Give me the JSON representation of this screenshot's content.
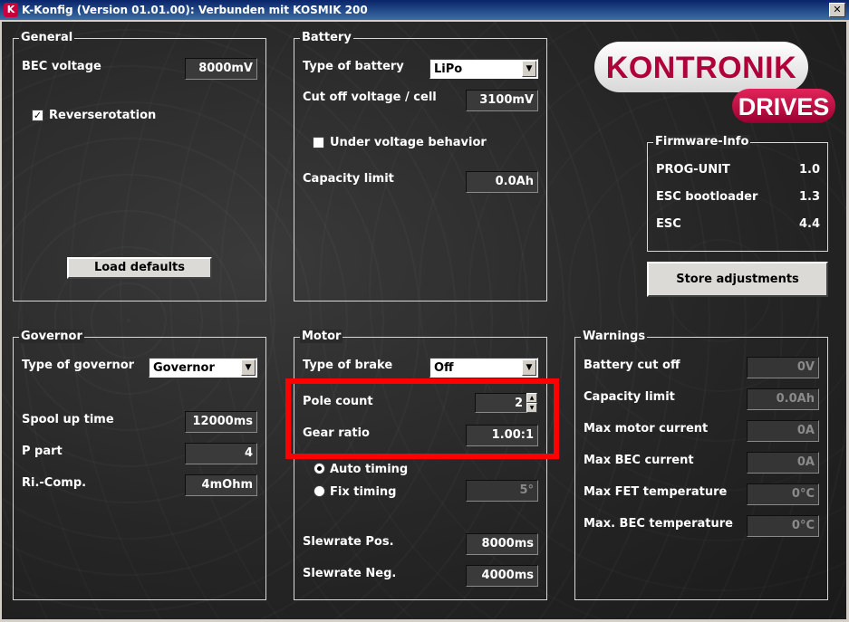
{
  "window": {
    "title": "K-Konfig (Version 01.01.00): Verbunden mit KOSMIK 200",
    "app_icon": "K",
    "close_glyph": "✕"
  },
  "logo": {
    "main": "KONTRONIK",
    "sub": "DRIVES"
  },
  "general": {
    "legend": "General",
    "bec_voltage_label": "BEC voltage",
    "bec_voltage_value": "8000mV",
    "reverserotation_label": "Reverserotation",
    "reverserotation_checked": true,
    "load_defaults_label": "Load defaults"
  },
  "battery": {
    "legend": "Battery",
    "type_label": "Type of battery",
    "type_value": "LiPo",
    "cutoff_label": "Cut off voltage / cell",
    "cutoff_value": "3100mV",
    "under_voltage_label": "Under voltage behavior",
    "under_voltage_checked": false,
    "capacity_label": "Capacity limit",
    "capacity_value": "0.0Ah"
  },
  "firmware": {
    "legend": "Firmware-Info",
    "rows": [
      {
        "label": "PROG-UNIT",
        "value": "1.0"
      },
      {
        "label": "ESC bootloader",
        "value": "1.3"
      },
      {
        "label": "ESC",
        "value": "4.4"
      }
    ],
    "store_label": "Store adjustments"
  },
  "governor": {
    "legend": "Governor",
    "type_label": "Type of governor",
    "type_value": "Governor",
    "spool_label": "Spool up time",
    "spool_value": "12000ms",
    "ppart_label": "P part",
    "ppart_value": "4",
    "ricomp_label": "Ri.-Comp.",
    "ricomp_value": "4mOhm"
  },
  "motor": {
    "legend": "Motor",
    "brake_label": "Type of brake",
    "brake_value": "Off",
    "pole_label": "Pole count",
    "pole_value": "2",
    "gear_label": "Gear ratio",
    "gear_value": "1.00:1",
    "auto_timing_label": "Auto timing",
    "fix_timing_label": "Fix timing",
    "fix_timing_value": "5°",
    "slew_pos_label": "Slewrate Pos.",
    "slew_pos_value": "8000ms",
    "slew_neg_label": "Slewrate Neg.",
    "slew_neg_value": "4000ms"
  },
  "warnings": {
    "legend": "Warnings",
    "rows": [
      {
        "label": "Battery cut off",
        "value": "0V"
      },
      {
        "label": "Capacity limit",
        "value": "0.0Ah"
      },
      {
        "label": "Max motor current",
        "value": "0A"
      },
      {
        "label": "Max BEC current",
        "value": "0A"
      },
      {
        "label": "Max FET temperature",
        "value": "0°C"
      },
      {
        "label": "Max. BEC temperature",
        "value": "0°C"
      }
    ]
  },
  "glyphs": {
    "check": "✓",
    "dropdown_arrow": "▼",
    "spin_up": "▲",
    "spin_down": "▼"
  },
  "colors": {
    "highlight": "#ff0000",
    "brand": "#b0003a"
  }
}
